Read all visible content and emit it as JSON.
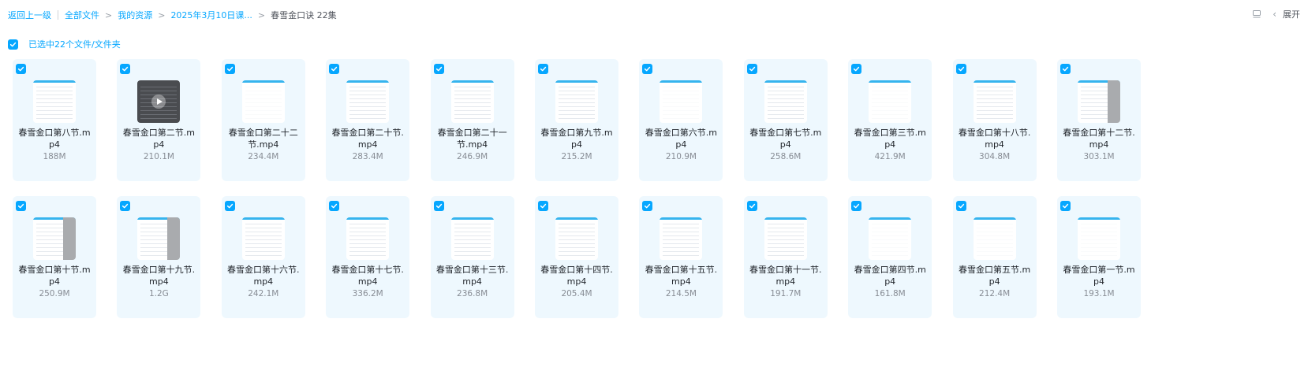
{
  "breadcrumb": {
    "back": "返回上一级",
    "items": [
      "全部文件",
      "我的资源",
      "2025年3月10日课...",
      "春雪金口诀 22集"
    ]
  },
  "toolbar": {
    "expand_label": "展开"
  },
  "selection": {
    "label": "已选中22个文件/文件夹",
    "checked": true
  },
  "colors": {
    "accent": "#06a7ff",
    "card_bg": "#eef8fe"
  },
  "files": [
    {
      "name": "春雪金口第八节.mp4",
      "size": "188M",
      "thumb": "doc"
    },
    {
      "name": "春雪金口第二节.mp4",
      "size": "210.1M",
      "thumb": "dark"
    },
    {
      "name": "春雪金口第二十二节.mp4",
      "size": "234.4M",
      "thumb": "blank"
    },
    {
      "name": "春雪金口第二十节.mp4",
      "size": "283.4M",
      "thumb": "doc"
    },
    {
      "name": "春雪金口第二十一节.mp4",
      "size": "246.9M",
      "thumb": "doc"
    },
    {
      "name": "春雪金口第九节.mp4",
      "size": "215.2M",
      "thumb": "doc"
    },
    {
      "name": "春雪金口第六节.mp4",
      "size": "210.9M",
      "thumb": "blank"
    },
    {
      "name": "春雪金口第七节.mp4",
      "size": "258.6M",
      "thumb": "doc"
    },
    {
      "name": "春雪金口第三节.mp4",
      "size": "421.9M",
      "thumb": "blank"
    },
    {
      "name": "春雪金口第十八节.mp4",
      "size": "304.8M",
      "thumb": "doc"
    },
    {
      "name": "春雪金口第十二节.mp4",
      "size": "303.1M",
      "thumb": "side"
    },
    {
      "name": "春雪金口第十节.mp4",
      "size": "250.9M",
      "thumb": "side"
    },
    {
      "name": "春雪金口第十九节.mp4",
      "size": "1.2G",
      "thumb": "side"
    },
    {
      "name": "春雪金口第十六节.mp4",
      "size": "242.1M",
      "thumb": "doc"
    },
    {
      "name": "春雪金口第十七节.mp4",
      "size": "336.2M",
      "thumb": "doc"
    },
    {
      "name": "春雪金口第十三节.mp4",
      "size": "236.8M",
      "thumb": "doc"
    },
    {
      "name": "春雪金口第十四节.mp4",
      "size": "205.4M",
      "thumb": "doc"
    },
    {
      "name": "春雪金口第十五节.mp4",
      "size": "214.5M",
      "thumb": "doc"
    },
    {
      "name": "春雪金口第十一节.mp4",
      "size": "191.7M",
      "thumb": "doc"
    },
    {
      "name": "春雪金口第四节.mp4",
      "size": "161.8M",
      "thumb": "blank"
    },
    {
      "name": "春雪金口第五节.mp4",
      "size": "212.4M",
      "thumb": "blank"
    },
    {
      "name": "春雪金口第一节.mp4",
      "size": "193.1M",
      "thumb": "blank"
    }
  ]
}
